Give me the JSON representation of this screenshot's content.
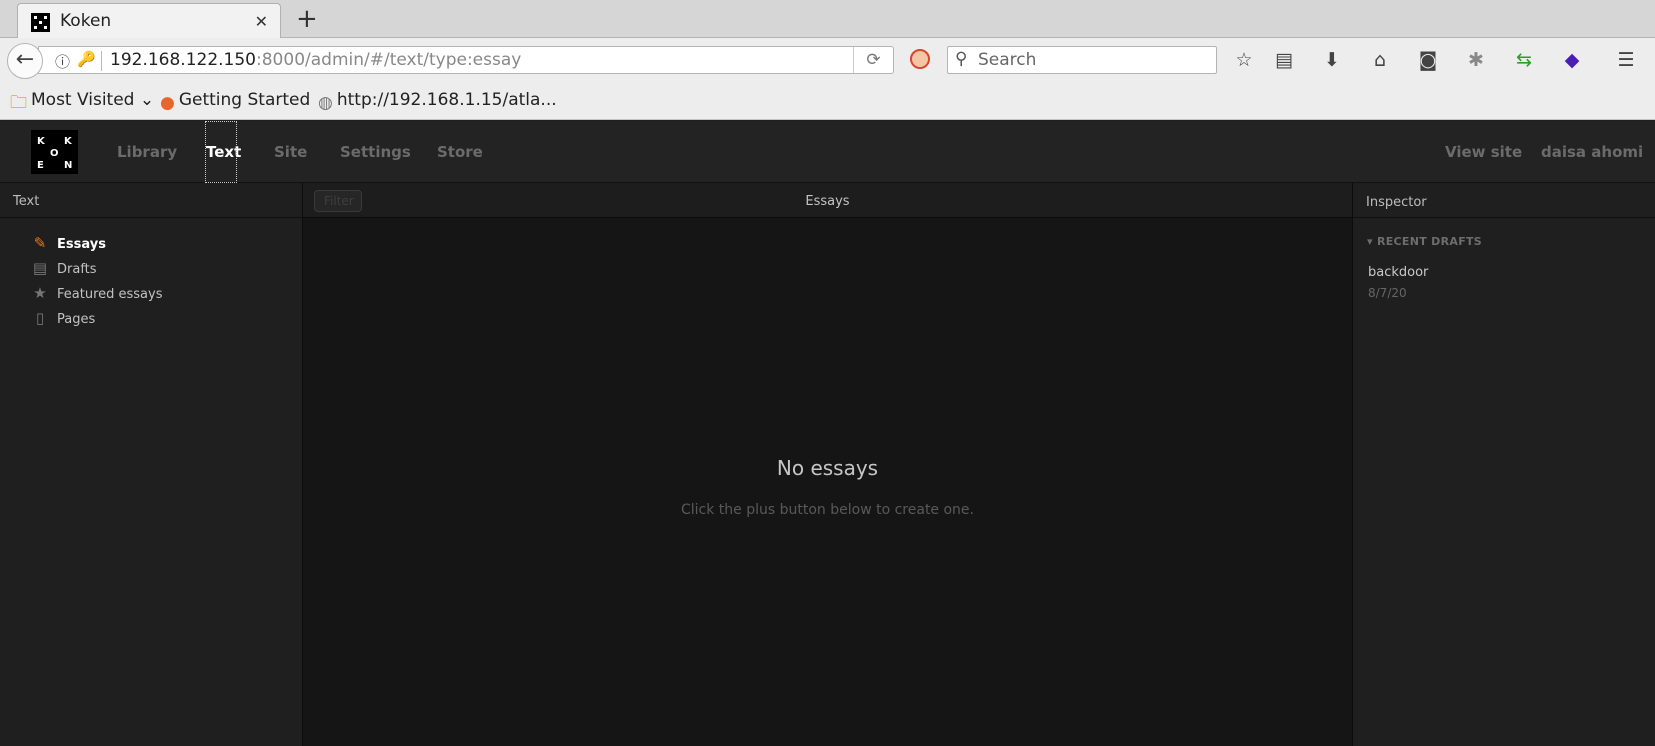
{
  "browser": {
    "tab_title": "Koken",
    "url_host": "192.168.122.150",
    "url_rest": ":8000/admin/#/text/type:essay",
    "search_placeholder": "Search",
    "bookmarks": [
      "Most Visited",
      "Getting Started",
      "http://192.168.1.15/atla..."
    ]
  },
  "app": {
    "logo_letters": [
      "K",
      "K",
      "O",
      "E",
      "N"
    ],
    "nav": [
      "Library",
      "Text",
      "Site",
      "Settings",
      "Store"
    ],
    "active_nav": "Text",
    "right_nav": [
      "View site",
      "daisa ahomi"
    ],
    "sidebar": {
      "title": "Text",
      "items": [
        "Essays",
        "Drafts",
        "Featured essays",
        "Pages"
      ],
      "active": "Essays"
    },
    "main": {
      "filter_placeholder": "Filter",
      "title": "Essays",
      "empty_title": "No essays",
      "empty_subtitle": "Click the plus button below to create one."
    },
    "inspector": {
      "title": "Inspector",
      "section": "RECENT DRAFTS",
      "draft_title": "backdoor",
      "draft_date": "8/7/20"
    }
  }
}
